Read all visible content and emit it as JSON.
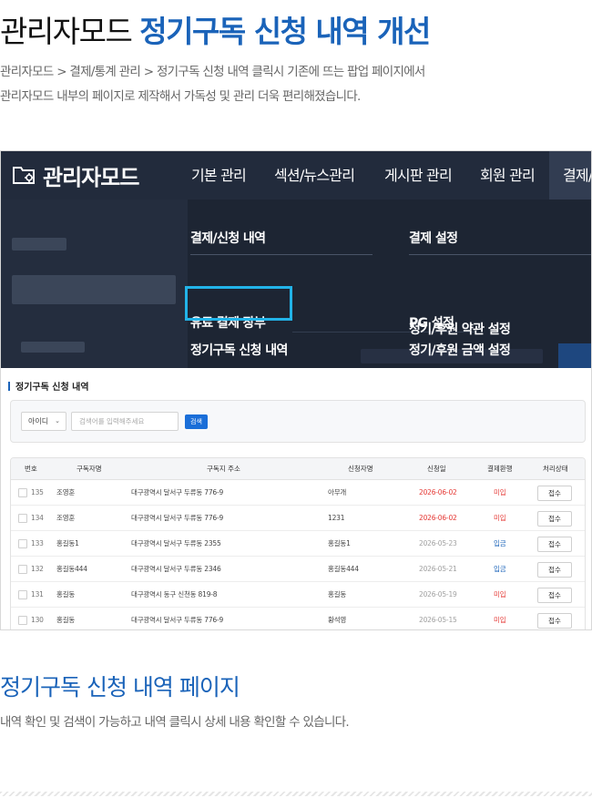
{
  "hero": {
    "title_plain": "관리자모드 ",
    "title_accent": "정기구독 신청 내역 개선",
    "desc_line1": "관리자모드 > 결제/통계 관리 > 정기구독 신청 내역 클릭시 기존에 뜨는 팝업 페이지에서",
    "desc_line2": "관리자모드 내부의 페이지로 제작해서 가독성 및 관리 더욱 편리해졌습니다."
  },
  "admin": {
    "logo_text": "관리자모드",
    "nav": [
      "기본 관리",
      "섹션/뉴스관리",
      "게시판 관리",
      "회원 관리",
      "결제/통계 관리"
    ],
    "dropdown": {
      "col1_title": "결제/신청 내역",
      "col1_items": [
        "유료 결제 장부",
        "정기구독 신청 내역"
      ],
      "col2_title": "결제 설정",
      "col2_items": [
        "PG 설정",
        "정기/후원 금액 설정",
        "정기/후원 약관 설정"
      ]
    }
  },
  "list_page": {
    "title": "정기구독 신청 내역",
    "search": {
      "select_value": "아이디",
      "placeholder": "검색어를 입력해주세요",
      "button": "검색"
    },
    "columns": [
      "번호",
      "구독자명",
      "구독지 주소",
      "신청자명",
      "신청일",
      "결제환행",
      "처리상태"
    ],
    "rows": [
      {
        "no": "135",
        "subscriber": "조영훈",
        "address": "대구광역시 달서구 두류동 776-9",
        "applicant": "아무개",
        "date": "2026-06-02",
        "date_red": true,
        "payment": "미입",
        "payment_color": "red",
        "status": "접수"
      },
      {
        "no": "134",
        "subscriber": "조영훈",
        "address": "대구광역시 달서구 두류동 776-9",
        "applicant": "1231",
        "date": "2026-06-02",
        "date_red": true,
        "payment": "미입",
        "payment_color": "red",
        "status": "접수"
      },
      {
        "no": "133",
        "subscriber": "홍길동1",
        "address": "대구광역시 달서구 두류동 2355",
        "applicant": "홍길동1",
        "date": "2026-05-23",
        "date_red": false,
        "payment": "입금",
        "payment_color": "blue",
        "status": "접수"
      },
      {
        "no": "132",
        "subscriber": "홍길동444",
        "address": "대구광역시 달서구 두류동 2346",
        "applicant": "홍길동444",
        "date": "2026-05-21",
        "date_red": false,
        "payment": "입금",
        "payment_color": "blue",
        "status": "접수"
      },
      {
        "no": "131",
        "subscriber": "홍길동",
        "address": "대구광역시 동구 신천동 819-8",
        "applicant": "홍길동",
        "date": "2026-05-19",
        "date_red": false,
        "payment": "미입",
        "payment_color": "red",
        "status": "접수"
      },
      {
        "no": "130",
        "subscriber": "홍길동",
        "address": "대구광역시 달서구 두류동 776-9",
        "applicant": "황석영",
        "date": "2026-05-15",
        "date_red": false,
        "payment": "미입",
        "payment_color": "red",
        "status": "접수"
      }
    ]
  },
  "section": {
    "title": "정기구독 신청 내역 페이지",
    "desc": "내역 확인 및 검색이 가능하고 내역 클릭시 상세 내용 확인할 수 있습니다."
  },
  "colors": {
    "accent_blue": "#1a63b9",
    "admin_bar": "#222b3c",
    "highlight": "#22b3e8",
    "unpaid_red": "#e53935"
  }
}
